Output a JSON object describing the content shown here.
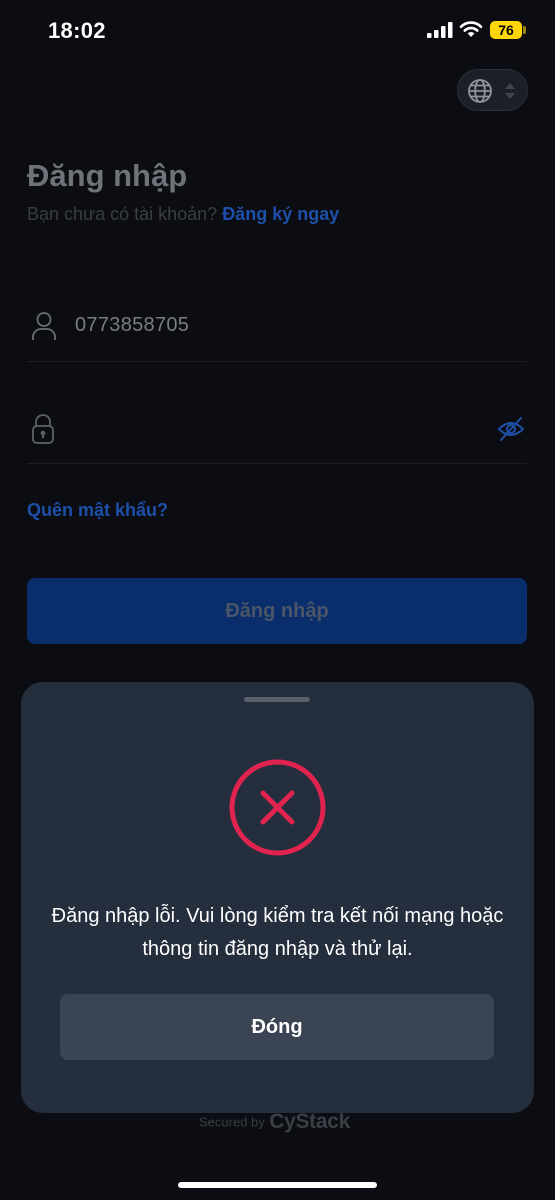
{
  "status_bar": {
    "time": "18:02",
    "battery": "76",
    "icons": [
      "signal-icon",
      "wifi-icon",
      "battery-icon"
    ]
  },
  "language_selector": {
    "icons": [
      "globe-icon",
      "chevron-up-down-icon"
    ]
  },
  "login": {
    "title": "Đăng nhập",
    "subtitle_text": "Bạn chưa có tài khoản? ",
    "signup_link": "Đăng ký ngay",
    "username_value": "0773858705",
    "password_value": "",
    "forgot_password": "Quên mật khẩu?",
    "submit_label": "Đăng nhập"
  },
  "footer": {
    "secured_by": "Secured by",
    "brand": "CyStack"
  },
  "error_sheet": {
    "icon": "error-x-icon",
    "message": "Đăng nhập lỗi. Vui lòng kiểm tra kết nối mạng hoặc thông tin đăng nhập và thử lại.",
    "close_label": "Đóng"
  },
  "colors": {
    "background": "#0b0d12",
    "sheet": "#252e3d",
    "primary_button": "#0a2e6b",
    "link": "#1e4fa8",
    "error": "#e0244f",
    "battery": "#ffd60a"
  }
}
